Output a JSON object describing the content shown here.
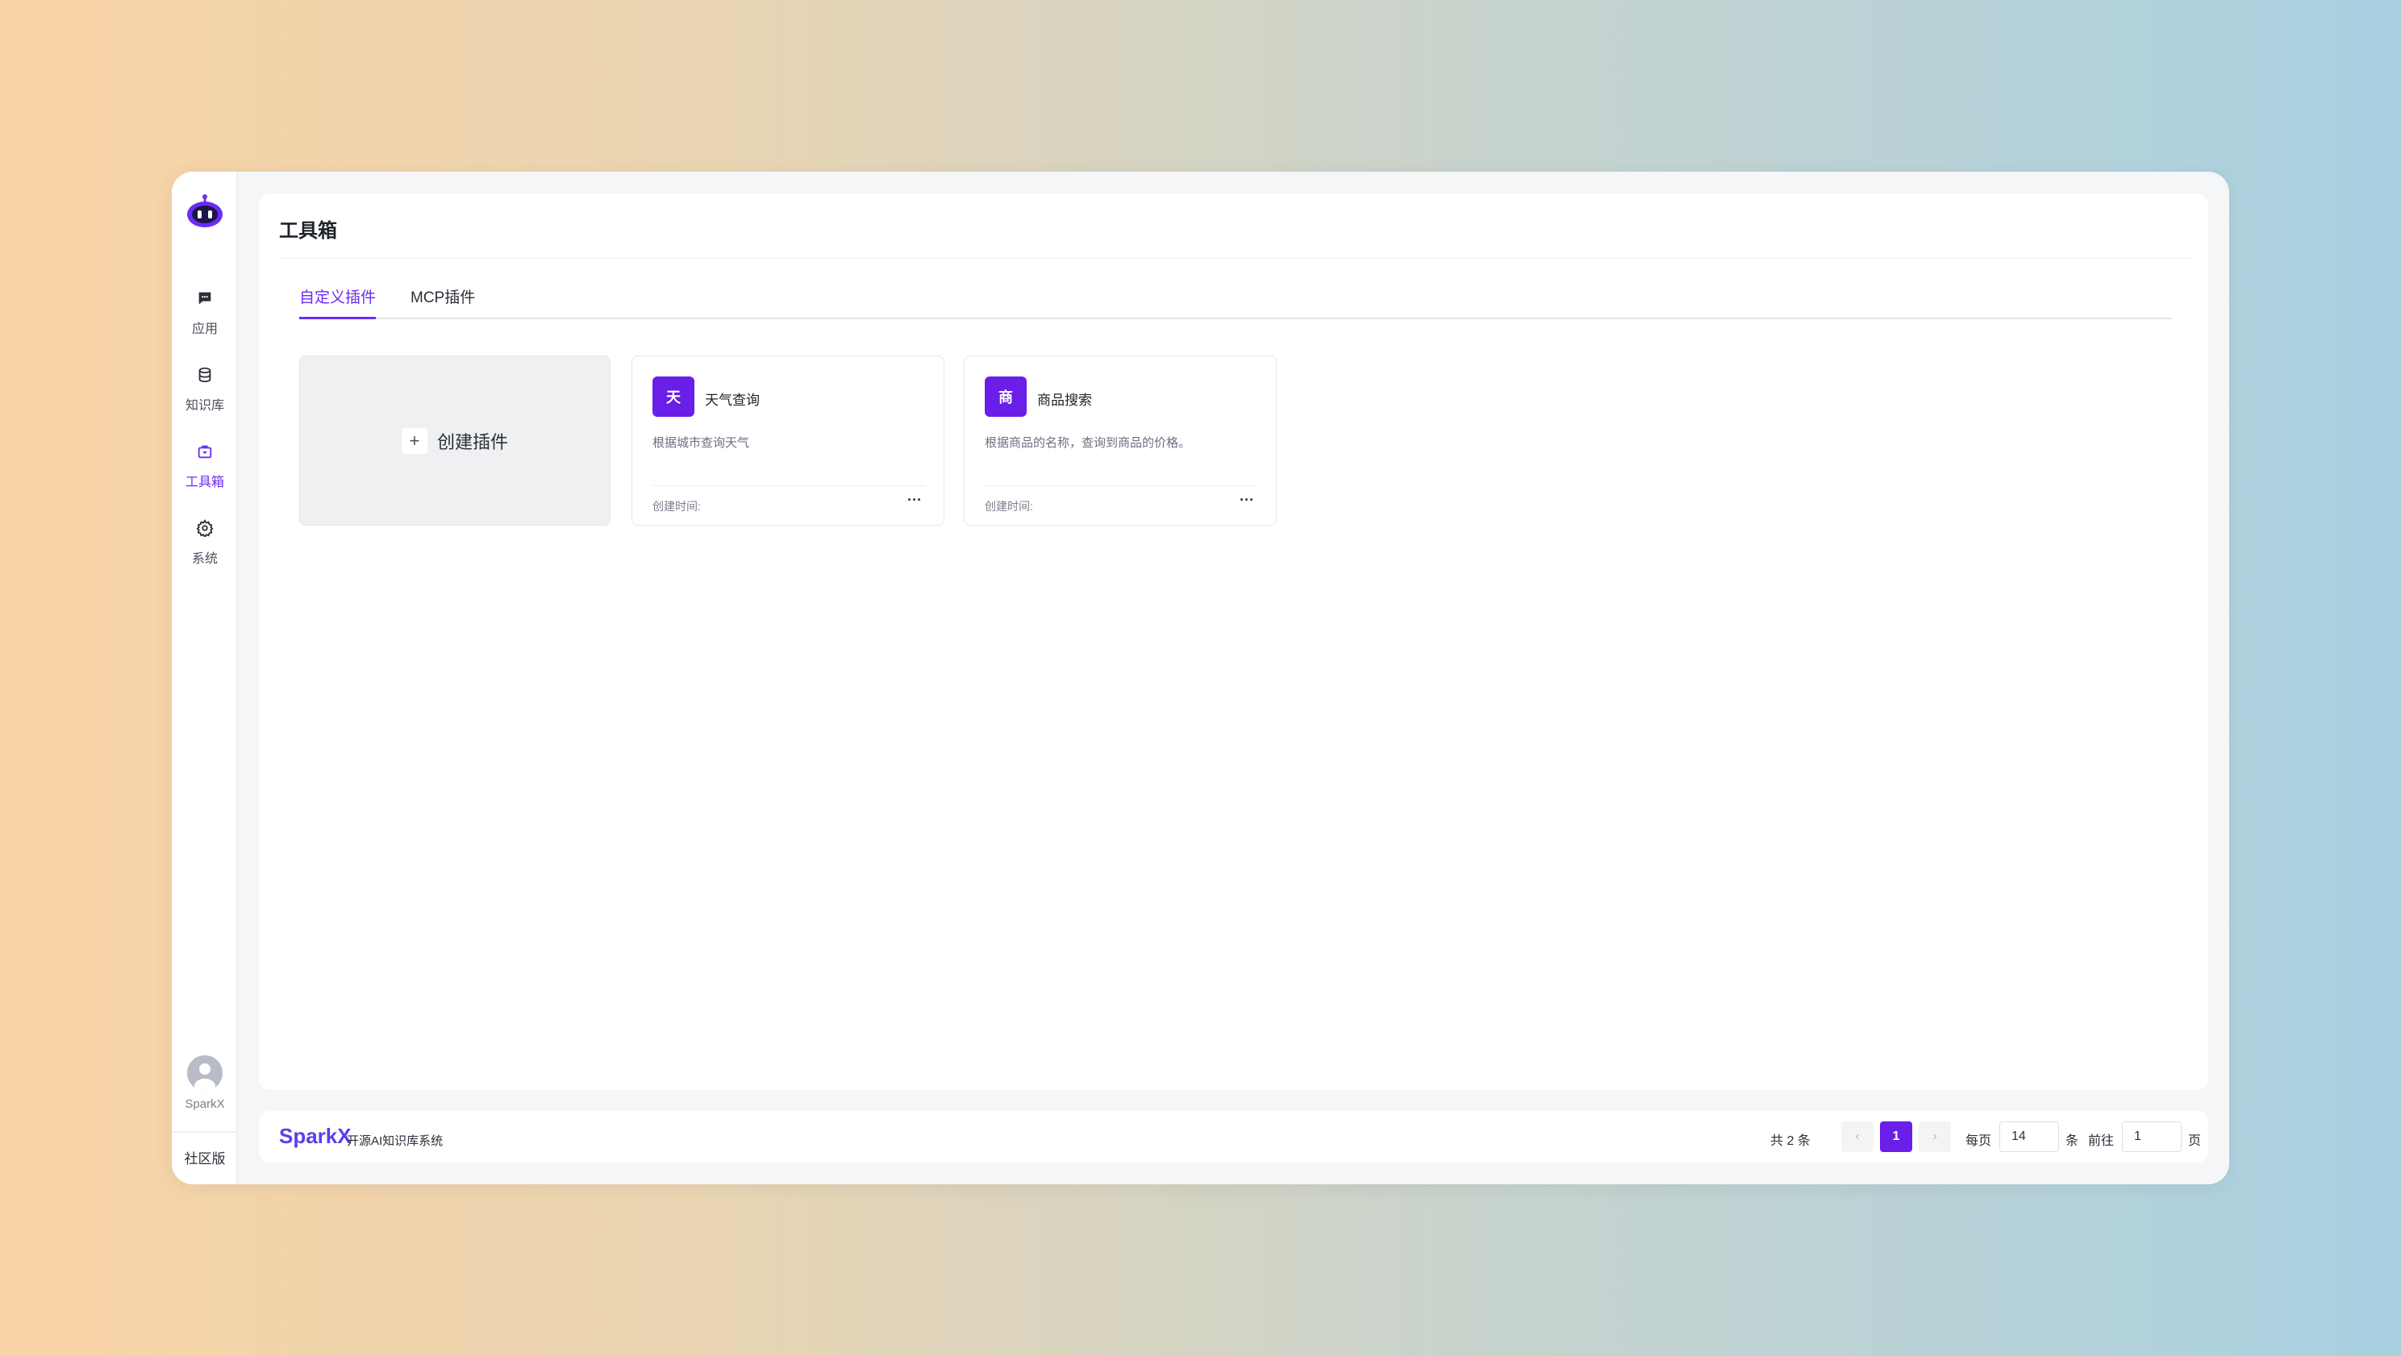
{
  "app": {
    "brand": "SparkX",
    "brand_subtitle": "开源AI知识库系统",
    "edition": "社区版"
  },
  "sidebar": {
    "items": [
      {
        "label": "应用",
        "icon": "chat-icon",
        "active": false
      },
      {
        "label": "知识库",
        "icon": "database-icon",
        "active": false
      },
      {
        "label": "工具箱",
        "icon": "toolbox-icon",
        "active": true
      },
      {
        "label": "系统",
        "icon": "gear-icon",
        "active": false
      }
    ],
    "user": {
      "name": "SparkX"
    }
  },
  "page": {
    "title": "工具箱",
    "tabs": [
      {
        "label": "自定义插件",
        "active": true
      },
      {
        "label": "MCP插件",
        "active": false
      }
    ]
  },
  "create_card": {
    "plus": "+",
    "label": "创建插件"
  },
  "plugins": [
    {
      "icon_char": "天",
      "title": "天气查询",
      "description": "根据城市查询天气",
      "created_label": "创建时间:",
      "more": "···"
    },
    {
      "icon_char": "商",
      "title": "商品搜索",
      "description": "根据商品的名称，查询到商品的价格。",
      "created_label": "创建时间:",
      "more": "···"
    }
  ],
  "pagination": {
    "total_text": "共 2 条",
    "prev": "‹",
    "current_page": "1",
    "next": "›",
    "per_page_label": "每页",
    "per_page_value": "14",
    "per_page_unit": "条",
    "goto_label": "前往",
    "goto_value": "1",
    "goto_unit": "页"
  },
  "colors": {
    "accent": "#6a2cf5",
    "icon_bg": "#6a1ee8",
    "brand": "#5a3fe8"
  }
}
